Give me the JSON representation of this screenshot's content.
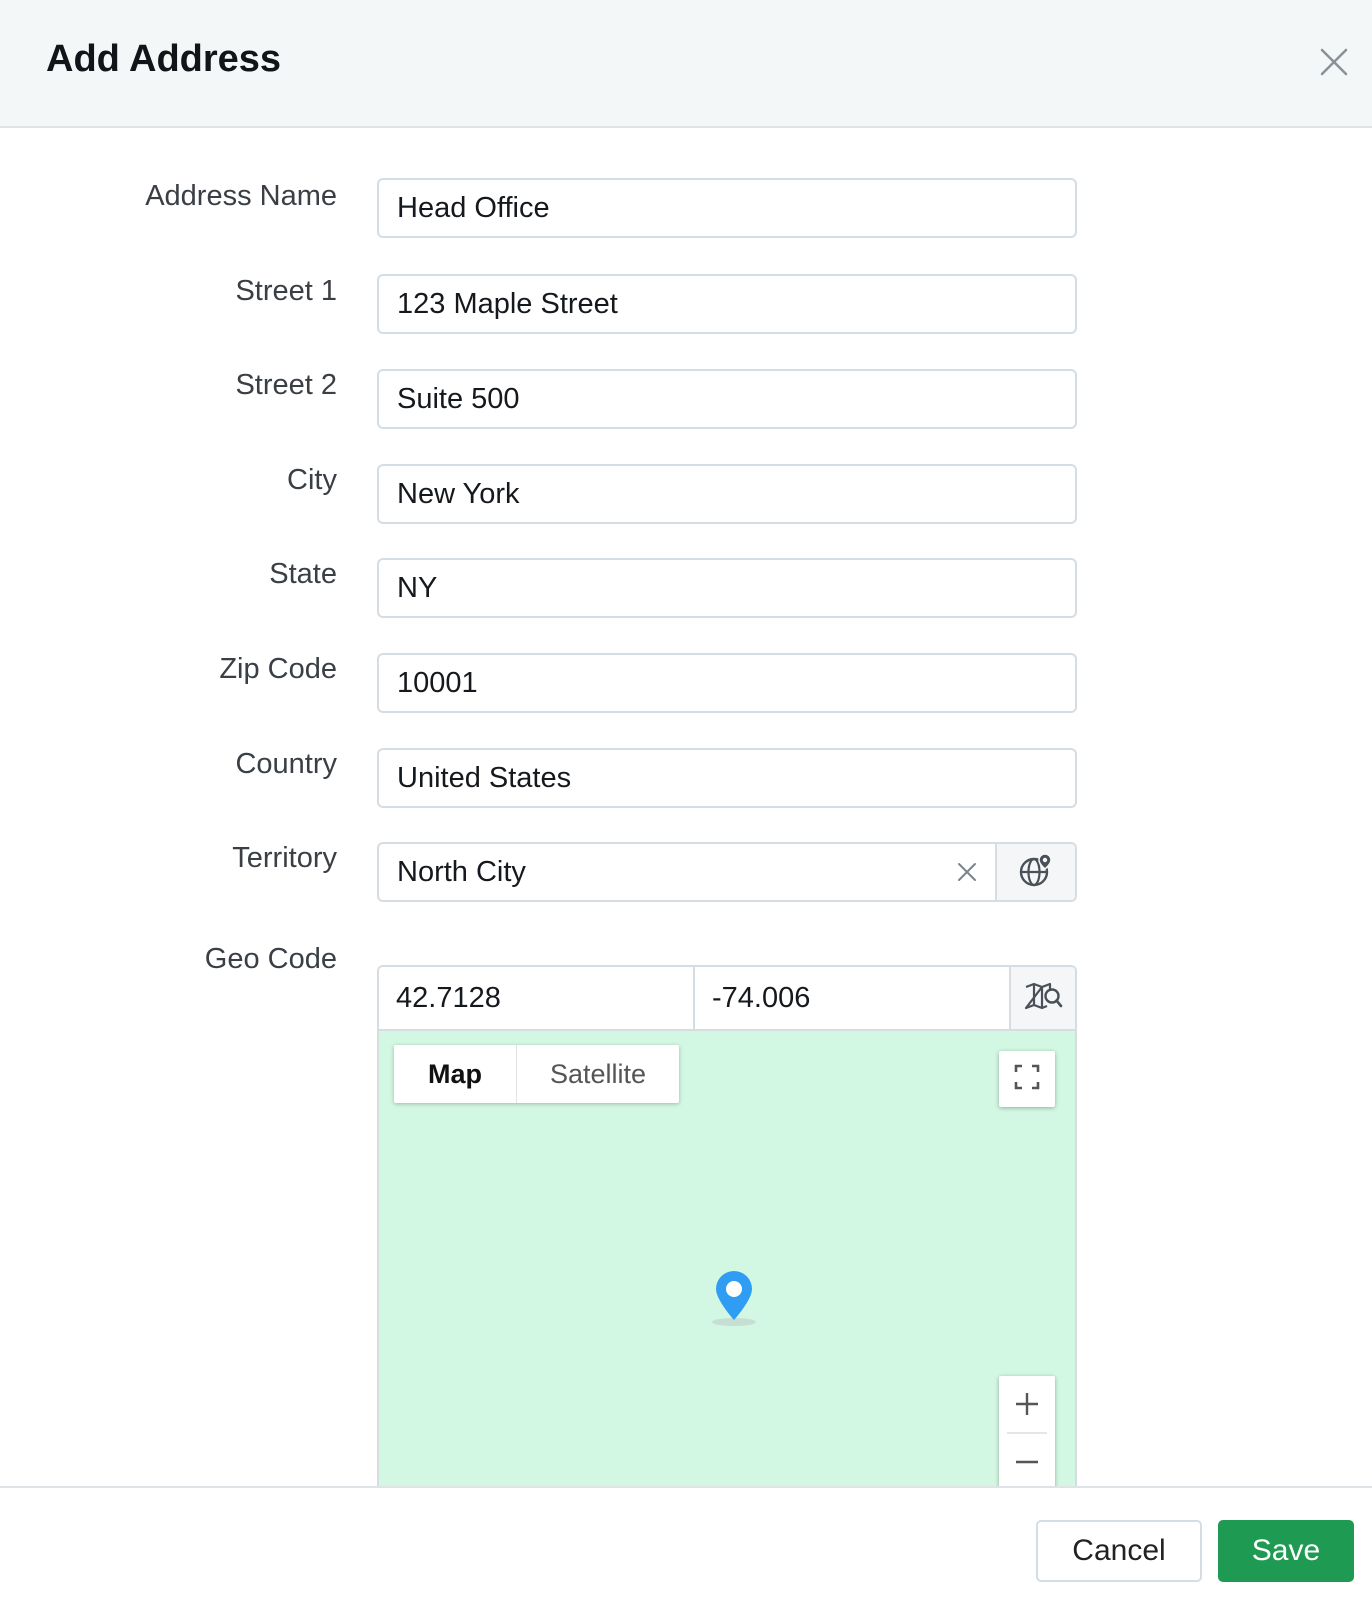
{
  "dialog": {
    "title": "Add Address"
  },
  "form": {
    "address_name": {
      "label": "Address Name",
      "value": "Head Office"
    },
    "street1": {
      "label": "Street 1",
      "value": "123 Maple Street"
    },
    "street2": {
      "label": "Street 2",
      "value": "Suite 500"
    },
    "city": {
      "label": "City",
      "value": "New York"
    },
    "state": {
      "label": "State",
      "value": "NY"
    },
    "zip": {
      "label": "Zip Code",
      "value": "10001"
    },
    "country": {
      "label": "Country",
      "value": "United States"
    },
    "territory": {
      "label": "Territory",
      "value": "North City"
    },
    "geo": {
      "label": "Geo Code",
      "latitude": "42.7128",
      "longitude": "-74.006"
    }
  },
  "map": {
    "type_options": [
      "Map",
      "Satellite"
    ],
    "selected_type": "Map",
    "background_color": "#d2f7e2",
    "pin_color": "#2f9df4",
    "zoom_in": "+",
    "zoom_out": "−"
  },
  "footer": {
    "cancel_label": "Cancel",
    "save_label": "Save",
    "save_color": "#1e9a52"
  },
  "icons": {
    "close": "close-icon",
    "territory_clear": "clear-icon",
    "territory_picker": "globe-pin-icon",
    "geo_search": "map-search-icon",
    "fullscreen": "fullscreen-icon",
    "pin": "map-pin-icon"
  }
}
